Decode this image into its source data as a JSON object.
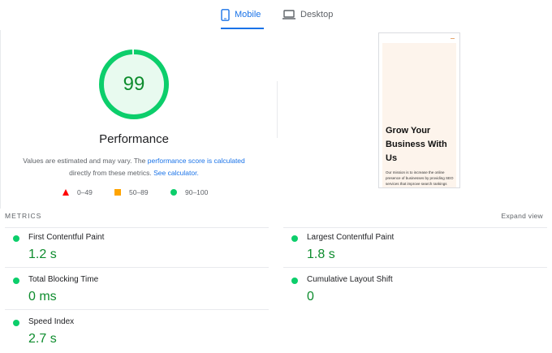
{
  "tabs": [
    {
      "label": "Mobile",
      "active": true
    },
    {
      "label": "Desktop",
      "active": false
    }
  ],
  "gauge": {
    "score": "99",
    "fraction": 0.99,
    "color": "#0cce6b"
  },
  "performance": {
    "title": "Performance",
    "desc_part1": "Values are estimated and may vary. The ",
    "desc_link1": "performance score is calculated",
    "desc_part2": " directly from these metrics. ",
    "desc_link2": "See calculator."
  },
  "legend": [
    {
      "label": "0–49",
      "icon": "triangle-fail-icon",
      "color": "#ff0000"
    },
    {
      "label": "50–89",
      "icon": "square-average-icon",
      "color": "#ffa400"
    },
    {
      "label": "90–100",
      "icon": "circle-pass-icon",
      "color": "#0cce6b"
    }
  ],
  "screenshot": {
    "headline": "Grow Your Business With Us",
    "body": "Our mission is to increase the online presence of businesses by providing SEO services that improve search rankings"
  },
  "metrics_header": {
    "label": "METRICS",
    "expand": "Expand view"
  },
  "metrics": [
    {
      "name": "First Contentful Paint",
      "value": "1.2 s"
    },
    {
      "name": "Largest Contentful Paint",
      "value": "1.8 s"
    },
    {
      "name": "Total Blocking Time",
      "value": "0 ms"
    },
    {
      "name": "Cumulative Layout Shift",
      "value": "0"
    },
    {
      "name": "Speed Index",
      "value": "2.7 s"
    }
  ],
  "colors": {
    "accent": "#1a73e8",
    "pass": "#0cce6b",
    "pass_text": "#0d8c2d"
  }
}
